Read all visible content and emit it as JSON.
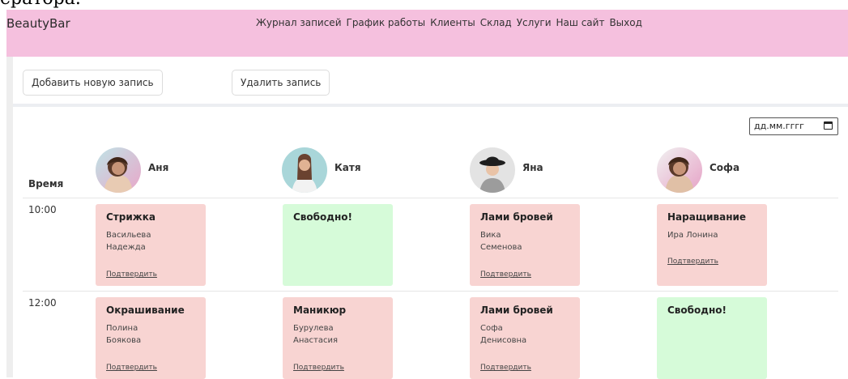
{
  "caption": "ератора.",
  "navbar": {
    "brand": "BeautyBar",
    "links": [
      "Журнал записей",
      "График работы",
      "Клиенты",
      "Склад",
      "Услуги",
      "Наш сайт",
      "Выход"
    ]
  },
  "toolbar": {
    "add_label": "Добавить новую запись",
    "delete_label": "Удалить запись"
  },
  "date_input": {
    "placeholder": "дд.мм.гггг"
  },
  "schedule": {
    "time_header": "Время",
    "staff": [
      "Аня",
      "Катя",
      "Яна",
      "Софа"
    ],
    "slots": [
      {
        "time": "10:00",
        "cards": [
          {
            "status": "busy",
            "service": "Стрижка",
            "client_lines": [
              "Васильева",
              "Надежда"
            ],
            "confirm": "Подтвердить"
          },
          {
            "status": "free",
            "service": "Свободно!",
            "client_lines": [],
            "confirm": ""
          },
          {
            "status": "busy",
            "service": "Лами бровей",
            "client_lines": [
              "Вика",
              "Семенова"
            ],
            "confirm": "Подтвердить"
          },
          {
            "status": "busy",
            "service": "Наращивание",
            "client_lines": [
              "Ира Лонина"
            ],
            "confirm": "Подтвердить"
          }
        ]
      },
      {
        "time": "12:00",
        "cards": [
          {
            "status": "busy",
            "service": "Окрашивание",
            "client_lines": [
              "Полина",
              "Боякова"
            ],
            "confirm": "Подтвердить"
          },
          {
            "status": "busy",
            "service": "Маникюр",
            "client_lines": [
              "Бурулева",
              "Анастасия"
            ],
            "confirm": "Подтвердить"
          },
          {
            "status": "busy",
            "service": "Лами бровей",
            "client_lines": [
              "Софа",
              "Денисовна"
            ],
            "confirm": "Подтвердить"
          },
          {
            "status": "free",
            "service": "Свободно!",
            "client_lines": [],
            "confirm": ""
          }
        ]
      }
    ]
  },
  "colors": {
    "navbar": "#f5c0de",
    "busy_card": "#f8d4d2",
    "free_card": "#d6fbd9"
  }
}
